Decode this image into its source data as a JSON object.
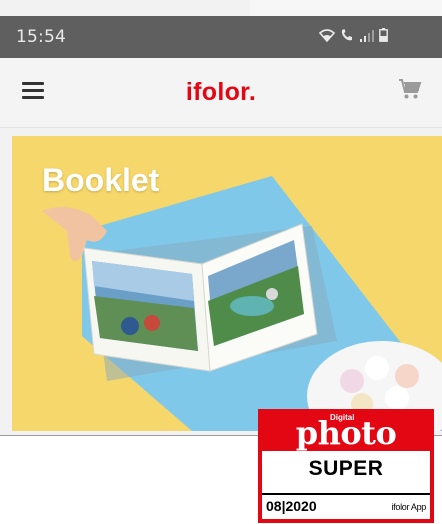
{
  "status_bar": {
    "time": "15:54",
    "icons": [
      "wifi-icon",
      "call-icon",
      "signal-icon",
      "battery-icon"
    ]
  },
  "app_bar": {
    "brand": "ifolor.",
    "brand_color": "#e30613",
    "menu_icon": "hamburger-menu-icon",
    "cart_icon": "shopping-cart-icon"
  },
  "banner": {
    "title": "Booklet",
    "background": "#f5d76b",
    "accent": "#7fc8ea"
  },
  "badge": {
    "digital": "Digital",
    "logo": "photo",
    "rating": "SUPER",
    "date": "08|2020",
    "source": "ifolor App",
    "color": "#e30613"
  }
}
